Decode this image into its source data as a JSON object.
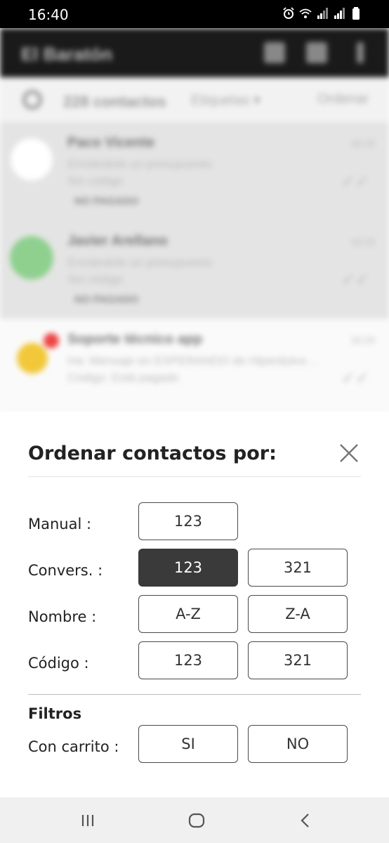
{
  "status_bar": {
    "time": "16:40",
    "icons": [
      "alarm-icon",
      "wifi-icon",
      "signal-icon",
      "signal-icon",
      "battery-icon"
    ]
  },
  "background": {
    "app_title": "El Baratón",
    "filter_count": "228 contactos",
    "filter_tags": "Etiquetas ▾",
    "filter_sort": "Ordenar",
    "contacts": [
      {
        "name": "Paco Vicente",
        "sub1": "Enviándole un presupuesto",
        "sub2": "Sin código",
        "tag": "NO PAGADO",
        "time": "16:29"
      },
      {
        "name": "Javier Arellano",
        "sub1": "Enviándole un presupuesto",
        "sub2": "Sin código",
        "tag": "NO PAGADO",
        "time": "16:29"
      },
      {
        "name": "Soporte técnico app",
        "sub1": "Ha: Mensaje en ESPERANDO de Hiperdulce…",
        "sub2": "Código: Está pagado",
        "tag": "",
        "time": "16:29"
      }
    ]
  },
  "sheet": {
    "title": "Ordenar contactos por:",
    "close_icon": "close-icon",
    "rows": [
      {
        "label": "Manual :",
        "options": [
          "123"
        ]
      },
      {
        "label": "Convers. :",
        "options": [
          "123",
          "321"
        ],
        "selected": 0
      },
      {
        "label": "Nombre :",
        "options": [
          "A-Z",
          "Z-A"
        ]
      },
      {
        "label": "Código :",
        "options": [
          "123",
          "321"
        ]
      }
    ],
    "filters_title": "Filtros",
    "filter_row": {
      "label": "Con carrito :",
      "options": [
        "SI",
        "NO"
      ]
    }
  },
  "nav_bar": {
    "icons": [
      "recents-icon",
      "home-icon",
      "back-icon"
    ]
  },
  "colors": {
    "selected_button": "#3a3a3a",
    "button_border": "#4a4a4a",
    "sheet_background": "#ffffff",
    "status_bar": "#000000"
  }
}
